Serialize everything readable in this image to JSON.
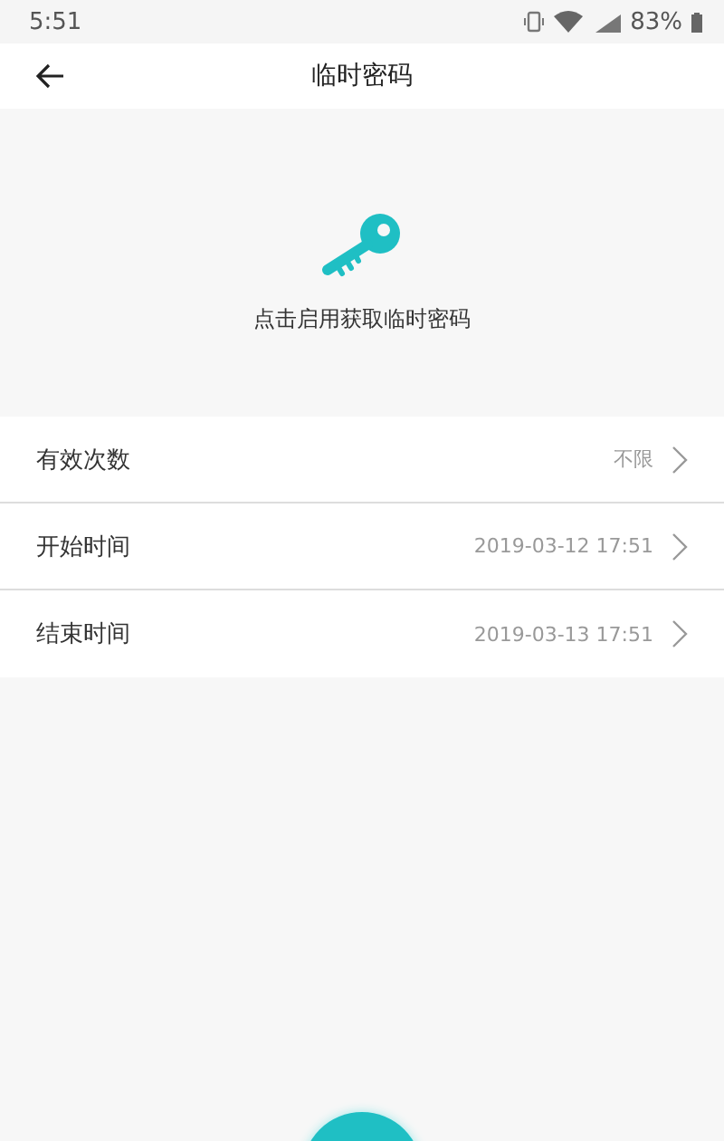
{
  "status_bar": {
    "time": "5:51",
    "battery": "83%"
  },
  "header": {
    "title": "临时密码"
  },
  "hero": {
    "hint": "点击启用获取临时密码"
  },
  "rows": [
    {
      "label": "有效次数",
      "value": "不限"
    },
    {
      "label": "开始时间",
      "value": "2019-03-12 17:51"
    },
    {
      "label": "结束时间",
      "value": "2019-03-13 17:51"
    }
  ]
}
